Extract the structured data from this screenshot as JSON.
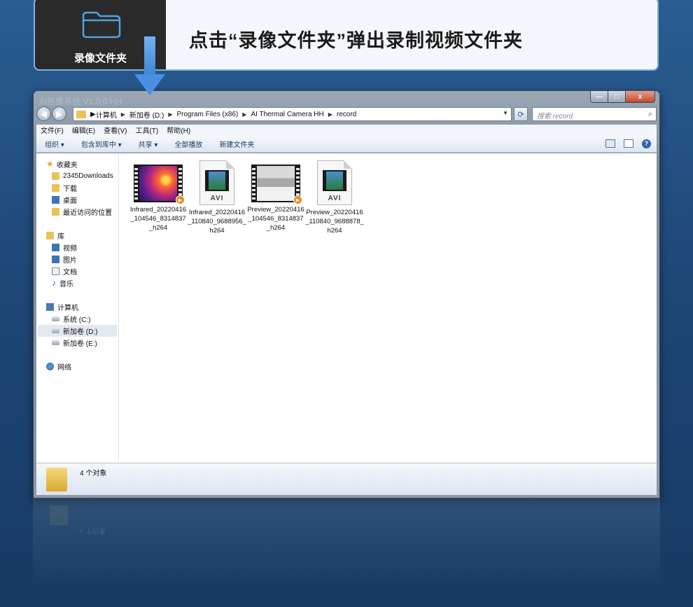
{
  "banner": {
    "tile_label": "录像文件夹",
    "tile_icon": "folder-outline-icon",
    "instruction": "点击“录像文件夹”弹出录制视频文件夹",
    "arrow_color": "#4a90e2"
  },
  "window": {
    "title": "AI热像系统 V1.0.0.HH",
    "controls": {
      "minimize": "—",
      "maximize": "□",
      "close": "x"
    }
  },
  "address_bar": {
    "crumbs": [
      "计算机",
      "新加卷 (D:)",
      "Program Files (x86)",
      "AI Thermal Camera HH",
      "record"
    ],
    "search_placeholder": "搜索 record"
  },
  "menubar": [
    "文件(F)",
    "编辑(E)",
    "查看(V)",
    "工具(T)",
    "帮助(H)"
  ],
  "toolbar": {
    "organize": "组织 ▾",
    "include_in_library": "包含到库中 ▾",
    "share": "共享 ▾",
    "play_all": "全部播放",
    "new_folder": "新建文件夹"
  },
  "sidebar": {
    "favorites": {
      "label": "收藏夹",
      "items": [
        "2345Downloads",
        "下载",
        "桌面",
        "最近访问的位置"
      ]
    },
    "libraries": {
      "label": "库",
      "items": [
        "视频",
        "图片",
        "文档",
        "音乐"
      ]
    },
    "computer": {
      "label": "计算机",
      "items": [
        "系统 (C:)",
        "新加卷 (D:)",
        "新加卷 (E:)"
      ],
      "selected": "新加卷 (D:)"
    },
    "network": {
      "label": "网络"
    }
  },
  "files": [
    {
      "name": "Infrared_20220416_104546_8314837_h264",
      "kind": "infrared-thumbnail"
    },
    {
      "name": "Infrared_20220416_110840_9688956_h264",
      "kind": "avi-document"
    },
    {
      "name": "Preview_20220416_104546_8314837_h264",
      "kind": "preview-thumbnail"
    },
    {
      "name": "Preview_20220416_110840_9688878_h264",
      "kind": "avi-document"
    }
  ],
  "avi_label": "AVI",
  "status": {
    "count_text": "4 个对象"
  }
}
